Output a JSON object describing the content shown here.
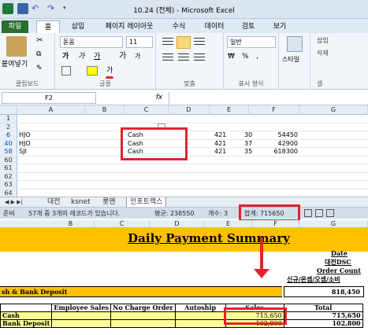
{
  "window": {
    "title": "10.24 (전체) - Microsoft Excel",
    "qat_icons": [
      "excel-logo-icon",
      "save-icon",
      "undo-icon",
      "redo-icon",
      "qat-dropdown-icon"
    ]
  },
  "tabs": [
    "파일",
    "홈",
    "삽입",
    "페이지 레이아웃",
    "수식",
    "데이터",
    "검토",
    "보기"
  ],
  "ribbon": {
    "paste_label": "붙여넣기",
    "clipboard_group": "클립보드",
    "font_name": "돋움",
    "font_size": "11",
    "grow_font": "가",
    "shrink_font": "가",
    "bold": "가",
    "italic": "가",
    "underline": "가",
    "font_color": "가",
    "font_group": "글꼴",
    "align_group": "맞춤",
    "number_format": "일반",
    "number_group": "표시 형식",
    "currency": "₩",
    "percent": "%",
    "comma": ",",
    "style_label": "스타일",
    "insert_label": "삽입",
    "delete_label": "삭제",
    "cells_group": "셀"
  },
  "formula_bar": {
    "name_box": "F2",
    "fx": "fx",
    "value": ""
  },
  "sheet1": {
    "columns": [
      "A",
      "B",
      "C",
      "D",
      "E",
      "F",
      "G"
    ],
    "rows": [
      {
        "num": "1",
        "a": "",
        "c": "",
        "e": "",
        "e2": "",
        "f": ""
      },
      {
        "num": "2",
        "a": "",
        "c": "",
        "e": "",
        "e2": "",
        "f": ""
      },
      {
        "num": "6",
        "a": "HJO",
        "c": "Cash",
        "e": "421",
        "e2": "30",
        "f": "54450"
      },
      {
        "num": "40",
        "a": "HJO",
        "c": "Cash",
        "e": "421",
        "e2": "37",
        "f": "42900"
      },
      {
        "num": "58",
        "a": "SJI",
        "c": "Cash",
        "e": "421",
        "e2": "35",
        "f": "618300"
      },
      {
        "num": "60",
        "a": "",
        "c": "",
        "e": "",
        "e2": "",
        "f": ""
      },
      {
        "num": "61",
        "a": "",
        "c": "",
        "e": "",
        "e2": "",
        "f": ""
      },
      {
        "num": "62",
        "a": "",
        "c": "",
        "e": "",
        "e2": "",
        "f": ""
      },
      {
        "num": "63",
        "a": "",
        "c": "",
        "e": "",
        "e2": "",
        "f": ""
      },
      {
        "num": "64",
        "a": "",
        "c": "",
        "e": "",
        "e2": "",
        "f": ""
      }
    ],
    "sheet_tabs": [
      "대전",
      "ksnet",
      "롯앤",
      "인포트랙스"
    ],
    "status": {
      "mode": "준비",
      "records": "57개 중 3개의 레코드가 있습니다.",
      "average": "평균: 238550",
      "count": "개수: 3",
      "sum": "합계: 715650"
    }
  },
  "sheet2": {
    "columns": [
      "B",
      "C",
      "D",
      "E",
      "F",
      "G"
    ],
    "title": "Daily Payment Summary",
    "date_label": "Date",
    "branch_label": "대전DSC",
    "order_count_label": "Order Count",
    "order_types": "신규/온셉/오셉/소비",
    "cash_deposit_label": "sh & Bank Deposit",
    "cash_deposit_total": "818,450",
    "table_headers": [
      "",
      "Employee Sales",
      "No Charge Order",
      "Autoship",
      "Sales",
      "Total"
    ],
    "table_rows": [
      {
        "label": "Cash",
        "sales": "715,650",
        "total": "715,650"
      },
      {
        "label": "Bank Deposit",
        "sales": "102,800",
        "total": "102,800"
      }
    ]
  },
  "highlight_color": "#e3222d"
}
